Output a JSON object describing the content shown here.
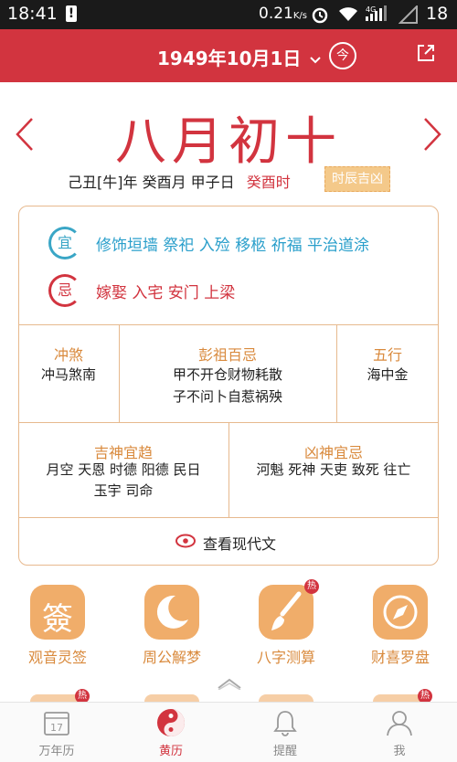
{
  "status_bar": {
    "time": "18:41",
    "net_speed": "0.21",
    "net_unit": "K/s",
    "battery": "18"
  },
  "header": {
    "date": "1949年10月1日",
    "today_label": "今"
  },
  "lunar": {
    "title": "八月初十",
    "ganzhi": "己丑[牛]年 癸酉月 甲子日",
    "hour": "癸酉时",
    "shichen_button": "时辰吉凶"
  },
  "almanac": {
    "yi_badge": "宜",
    "yi_text": "修饰垣墙 祭祀 入殓 移柩 祈福 平治道涂",
    "ji_badge": "忌",
    "ji_text": "嫁娶 入宅 安门 上梁",
    "chongsha_title": "冲煞",
    "chongsha_value": "冲马煞南",
    "pengzu_title": "彭祖百忌",
    "pengzu_line1": "甲不开仓财物耗散",
    "pengzu_line2": "子不问卜自惹祸殃",
    "wuxing_title": "五行",
    "wuxing_value": "海中金",
    "jishen_title": "吉神宜趋",
    "jishen_line1": "月空 天恩 时德 阳德 民日",
    "jishen_line2": "玉宇 司命",
    "xiongshen_title": "凶神宜忌",
    "xiongshen_value": "河魁 死神 天吏 致死 往亡",
    "modern_link": "查看现代文"
  },
  "features": {
    "guanyin": "观音灵签",
    "zhougong": "周公解梦",
    "bazi": "八字测算",
    "caixi": "财喜罗盘",
    "hot_label": "热",
    "guanyin_glyph": "簽"
  },
  "tabs": {
    "calendar": "万年历",
    "calendar_day": "17",
    "almanac": "黄历",
    "reminder": "提醒",
    "me": "我"
  },
  "colors": {
    "brand_red": "#d2343f",
    "accent_orange": "#f0ad6a",
    "yi_blue": "#2a9fcb",
    "card_border": "#e7b98e"
  }
}
